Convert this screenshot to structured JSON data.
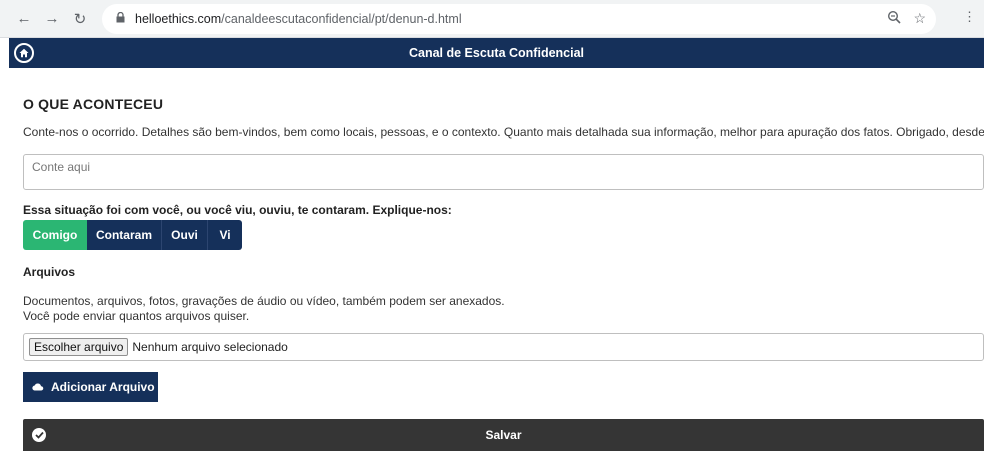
{
  "browser": {
    "url_host": "helloethics.com",
    "url_path": "/canaldeescutaconfidencial/pt/denun-d.html",
    "icons": [
      "back-arrow-icon",
      "forward-arrow-icon",
      "reload-icon",
      "lock-icon",
      "zoom-icon",
      "star-icon",
      "menu-dots-icon"
    ]
  },
  "header": {
    "title": "Canal de Escuta Confidencial",
    "home_icon": "home-icon"
  },
  "form": {
    "section_title": "O QUE ACONTECEU",
    "intro": "Conte-nos o ocorrido. Detalhes são bem-vindos, bem como locais, pessoas, e o contexto. Quanto mais detalhada sua informação, melhor para apuração dos fatos. Obrigado, desde já.",
    "story_placeholder": "Conte aqui",
    "story_value": "",
    "question": "Essa situação foi com você, ou você viu, ouviu, te contaram. Explique-nos:",
    "choices": [
      "Comigo",
      "Contaram",
      "Ouvi",
      "Vi"
    ],
    "selected_choice": "Comigo",
    "files_title": "Arquivos",
    "files_desc_line1": "Documentos, arquivos, fotos, gravações de áudio ou vídeo, também podem ser anexados.",
    "files_desc_line2": "Você pode enviar quantos arquivos quiser.",
    "file_button": "Escolher arquivo",
    "file_status": "Nenhum arquivo selecionado",
    "add_file_button": "Adicionar Arquivo",
    "save_button": "Salvar"
  },
  "colors": {
    "header_bg": "#15305a",
    "active_choice": "#2bb673",
    "save_bg": "#353535"
  }
}
